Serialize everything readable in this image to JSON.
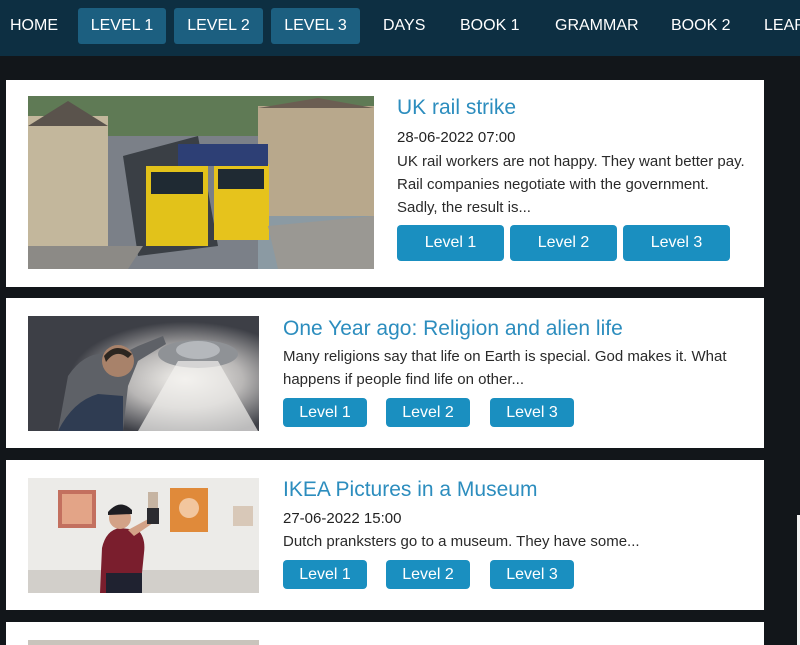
{
  "nav": {
    "items": [
      {
        "label": "HOME"
      },
      {
        "label": "LEVEL 1"
      },
      {
        "label": "LEVEL 2"
      },
      {
        "label": "LEVEL 3"
      },
      {
        "label": "DAYS"
      },
      {
        "label": "BOOK 1"
      },
      {
        "label": "GRAMMAR"
      },
      {
        "label": "BOOK 2"
      },
      {
        "label": "LEAR"
      }
    ]
  },
  "articles": [
    {
      "title": "UK rail strike",
      "date": "28-06-2022 07:00",
      "summary": "UK rail workers are not happy. They want better pay. Rail companies negotiate with the government. Sadly, the result is...",
      "levels": [
        "Level 1",
        "Level 2",
        "Level 3"
      ],
      "image": "train-station-photo"
    },
    {
      "title": "One Year ago: Religion and alien life",
      "summary": "Many religions say that life on Earth is special. God makes it. What happens if people find life on other...",
      "levels": [
        "Level 1",
        "Level 2",
        "Level 3"
      ],
      "image": "ufo-man-photo"
    },
    {
      "title": "IKEA Pictures in a Museum",
      "date": "27-06-2022 15:00",
      "summary": "Dutch pranksters go to a museum. They have some...",
      "levels": [
        "Level 1",
        "Level 2",
        "Level 3"
      ],
      "image": "museum-woman-photo"
    }
  ]
}
